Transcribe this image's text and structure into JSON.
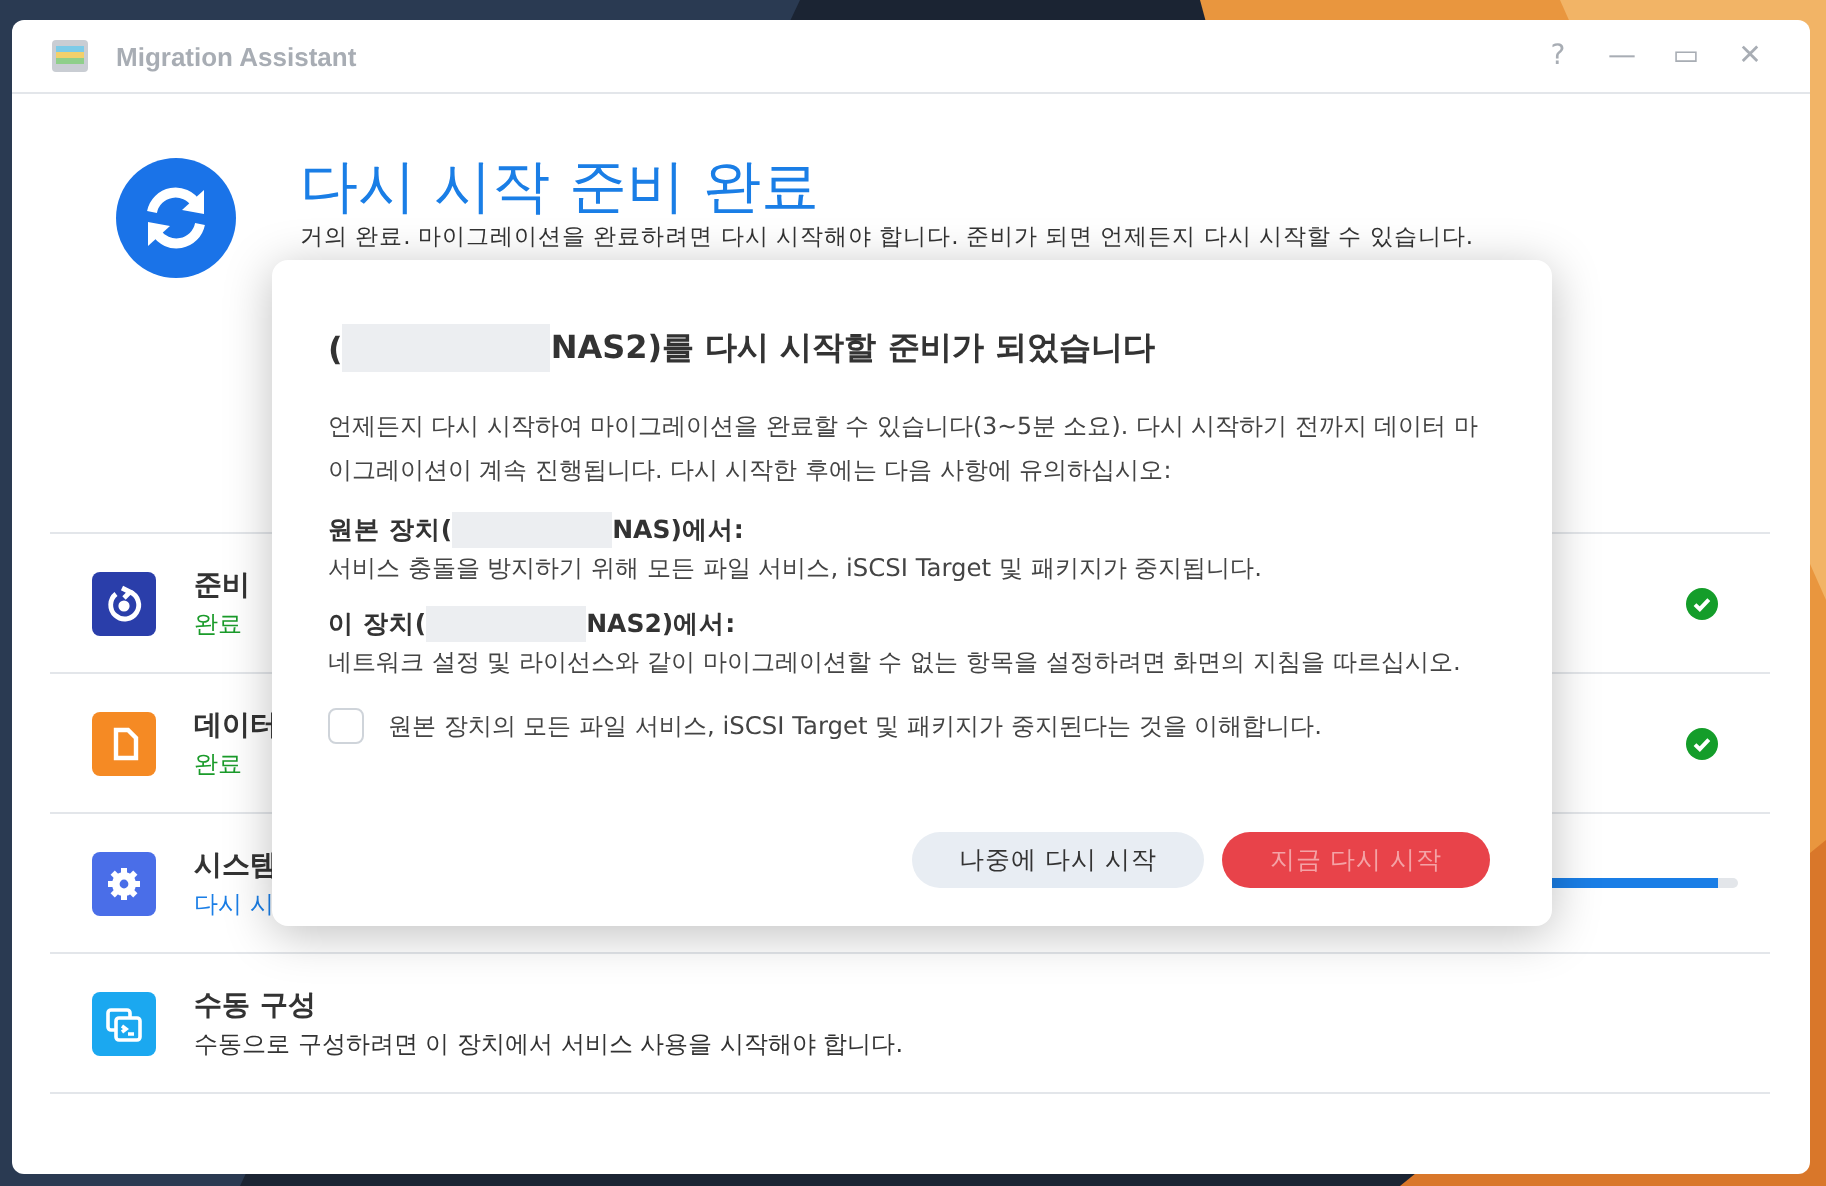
{
  "window": {
    "title": "Migration Assistant",
    "controls": [
      "?",
      "—",
      "▭",
      "✕"
    ]
  },
  "header": {
    "title": "다시 시작 준비 완료",
    "subtitle": "거의 완료. 마이그레이션을 완료하려면 다시 시작해야 합니다. 준비가 되면 언제든지 다시 시작할 수 있습니다."
  },
  "steps": [
    {
      "kind": "done",
      "title": "준비",
      "status": "완료"
    },
    {
      "kind": "done",
      "title": "데이터",
      "status": "완료"
    },
    {
      "kind": "progress",
      "title": "시스템",
      "status": "다시 시",
      "level": 0.92
    },
    {
      "kind": "info",
      "title": "수동 구성",
      "status": "수동으로 구성하려면 이 장치에서 서비스 사용을 시작해야 합니다."
    }
  ],
  "dialog": {
    "title": [
      {
        "kind": "text",
        "text": "("
      },
      {
        "kind": "redacted"
      },
      {
        "kind": "text",
        "text": "NAS2)를 다시 시작할 준비가 되었습니다"
      }
    ],
    "intro": "언제든지 다시 시작하여 마이그레이션을 완료할 수 있습니다(3~5분 소요). 다시 시작하기 전까지 데이터 마이그레이션이 계속 진행됩니다. 다시 시작한 후에는 다음 사항에 유의하십시오:",
    "sections": [
      {
        "heading": [
          {
            "kind": "text",
            "text": "원본 장치("
          },
          {
            "kind": "redacted"
          },
          {
            "kind": "text",
            "text": "NAS)에서:"
          }
        ],
        "body": "서비스 충돌을 방지하기 위해 모든 파일 서비스, iSCSI Target 및 패키지가 중지됩니다."
      },
      {
        "heading": [
          {
            "kind": "text",
            "text": "이 장치("
          },
          {
            "kind": "redacted"
          },
          {
            "kind": "text",
            "text": "NAS2)에서:"
          }
        ],
        "body": "네트워크 설정 및 라이선스와 같이 마이그레이션할 수 없는 항목을 설정하려면 화면의 지침을 따르십시오."
      }
    ],
    "checkbox": {
      "label": "원본 장치의 모든 파일 서비스, iSCSI Target 및 패키지가 중지된다는 것을 이해합니다.",
      "checked": false
    },
    "buttons": [
      {
        "kind": "secondary",
        "label": "나중에 다시 시작",
        "disabled": false
      },
      {
        "kind": "primary",
        "label": "지금 다시 시작",
        "disabled": true
      }
    ]
  }
}
